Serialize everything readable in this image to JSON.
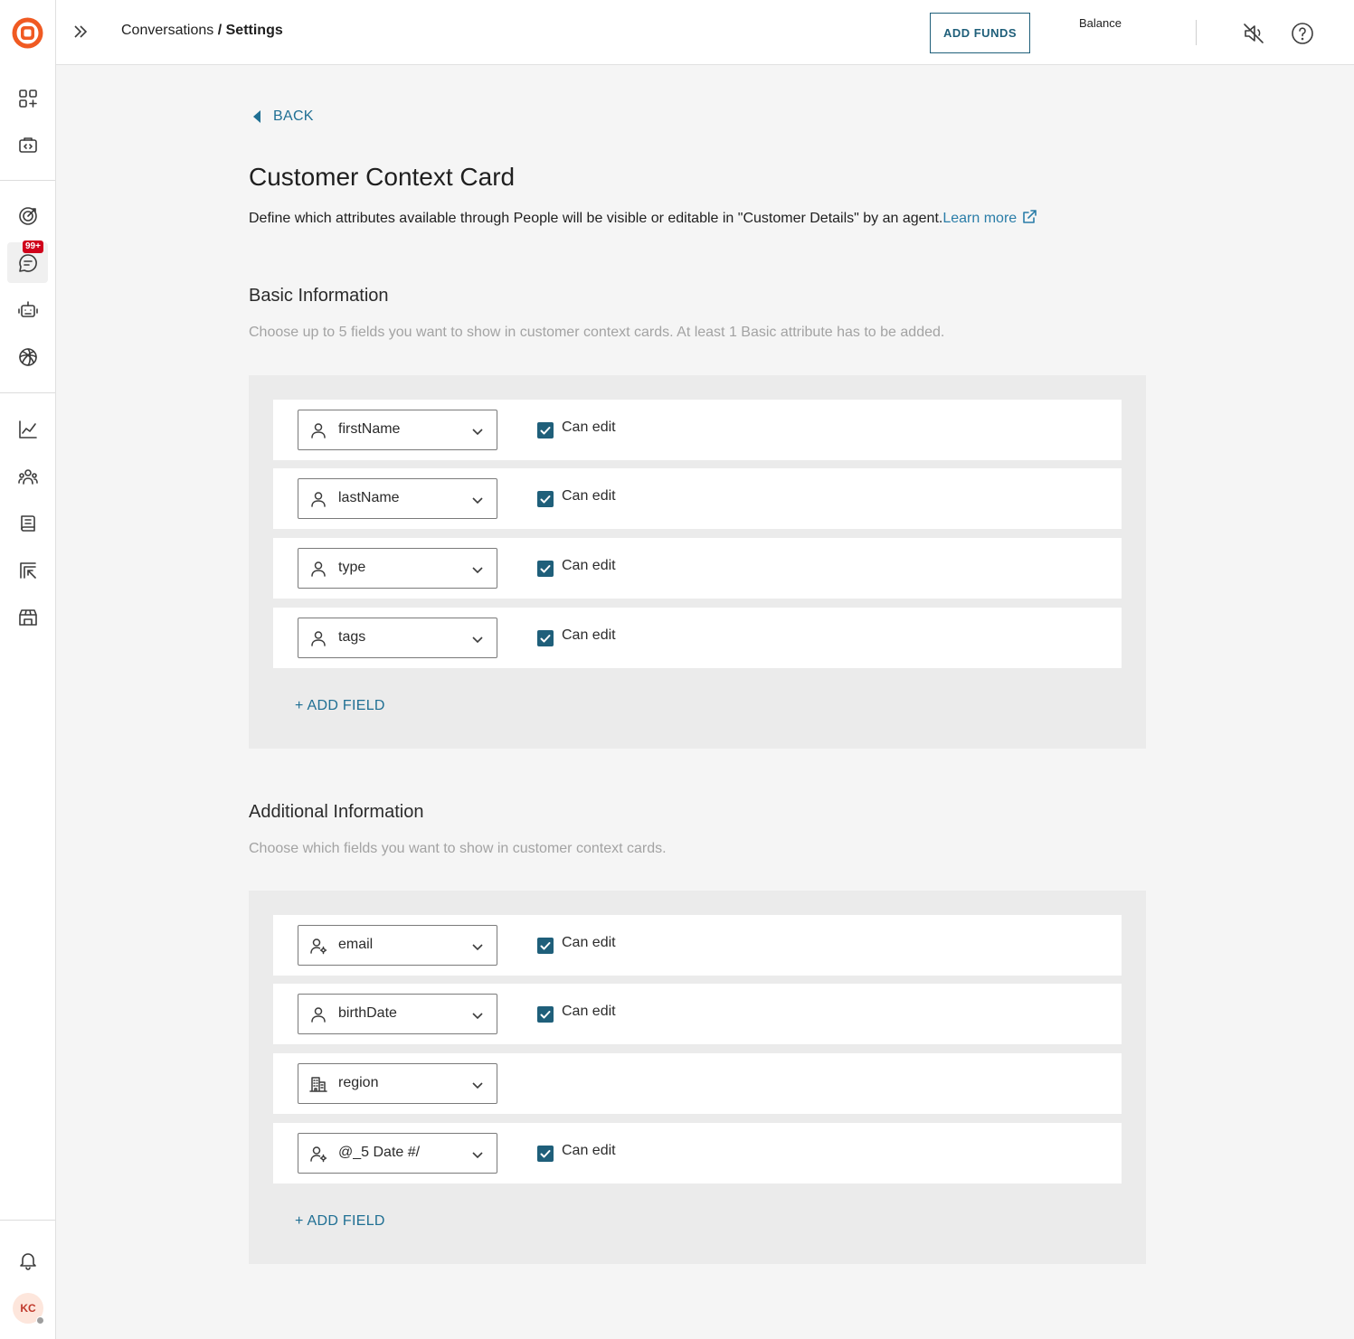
{
  "header": {
    "breadcrumb_parent": "Conversations",
    "breadcrumb_sep": " / ",
    "breadcrumb_current": "Settings",
    "add_funds_label": "ADD FUNDS",
    "balance_label": "Balance"
  },
  "sidebar": {
    "badge": "99+",
    "avatar_initials": "KC"
  },
  "page": {
    "back_label": "BACK",
    "title": "Customer Context Card",
    "description": "Define which attributes available through People will be visible or editable in \"Customer Details\" by an agent.",
    "learn_more": "Learn more"
  },
  "basic": {
    "title": "Basic Information",
    "subtitle": "Choose up to 5 fields you want to show in customer context cards. At least 1 Basic attribute has to be added.",
    "add_field": "+ ADD FIELD",
    "fields": [
      {
        "name": "firstName",
        "icon": "person-icon",
        "can_edit": "Can edit"
      },
      {
        "name": "lastName",
        "icon": "person-icon",
        "can_edit": "Can edit"
      },
      {
        "name": "type",
        "icon": "person-icon",
        "can_edit": "Can edit"
      },
      {
        "name": "tags",
        "icon": "person-icon",
        "can_edit": "Can edit"
      }
    ]
  },
  "additional": {
    "title": "Additional Information",
    "subtitle": "Choose which fields you want to show in customer context cards.",
    "add_field": "+ ADD FIELD",
    "fields": [
      {
        "name": "email",
        "icon": "person-settings-icon",
        "can_edit": "Can edit"
      },
      {
        "name": "birthDate",
        "icon": "person-icon",
        "can_edit": "Can edit"
      },
      {
        "name": "region",
        "icon": "company-icon",
        "can_edit": ""
      },
      {
        "name": "@_5 Date #/",
        "icon": "person-settings-icon",
        "can_edit": "Can edit"
      }
    ]
  },
  "colors": {
    "accent": "#1f5f7a",
    "link": "#2a7da8",
    "logo": "#f05a22",
    "badge": "#d0021b"
  }
}
